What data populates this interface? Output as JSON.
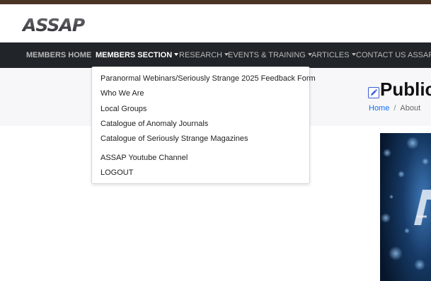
{
  "logo": {
    "text": "ASSAP"
  },
  "nav": {
    "items": [
      {
        "label": "MEMBERS HOME",
        "has_caret": false
      },
      {
        "label": "MEMBERS SECTION",
        "has_caret": true
      },
      {
        "label": "RESEARCH",
        "has_caret": true
      },
      {
        "label": "EVENTS & TRAINING",
        "has_caret": true
      },
      {
        "label": "ARTICLES",
        "has_caret": true
      },
      {
        "label": "CONTACT US",
        "has_caret": false
      },
      {
        "label": "ASSAP",
        "has_caret": false
      }
    ]
  },
  "dropdown": {
    "items": [
      "Paranormal Webinars/Seriously Strange 2025 Feedback Form",
      "Who We Are",
      "Local Groups",
      "Catalogue of Anomaly Journals",
      "Catalogue of Seriously Strange Magazines",
      "ASSAP Youtube Channel",
      "LOGOUT"
    ]
  },
  "page": {
    "title": "Public",
    "breadcrumb": {
      "home": "Home",
      "separator": "/",
      "current": "About"
    }
  },
  "colors": {
    "top_stripe": "#4a3426",
    "navbar_bg": "#212529",
    "nav_text": "#b7b7b7",
    "nav_active": "#ffffff",
    "link": "#0d6efd",
    "header_band": "#f7f7f9"
  },
  "icons": {
    "edit": "pencil-icon",
    "caret": "caret-down-icon"
  }
}
